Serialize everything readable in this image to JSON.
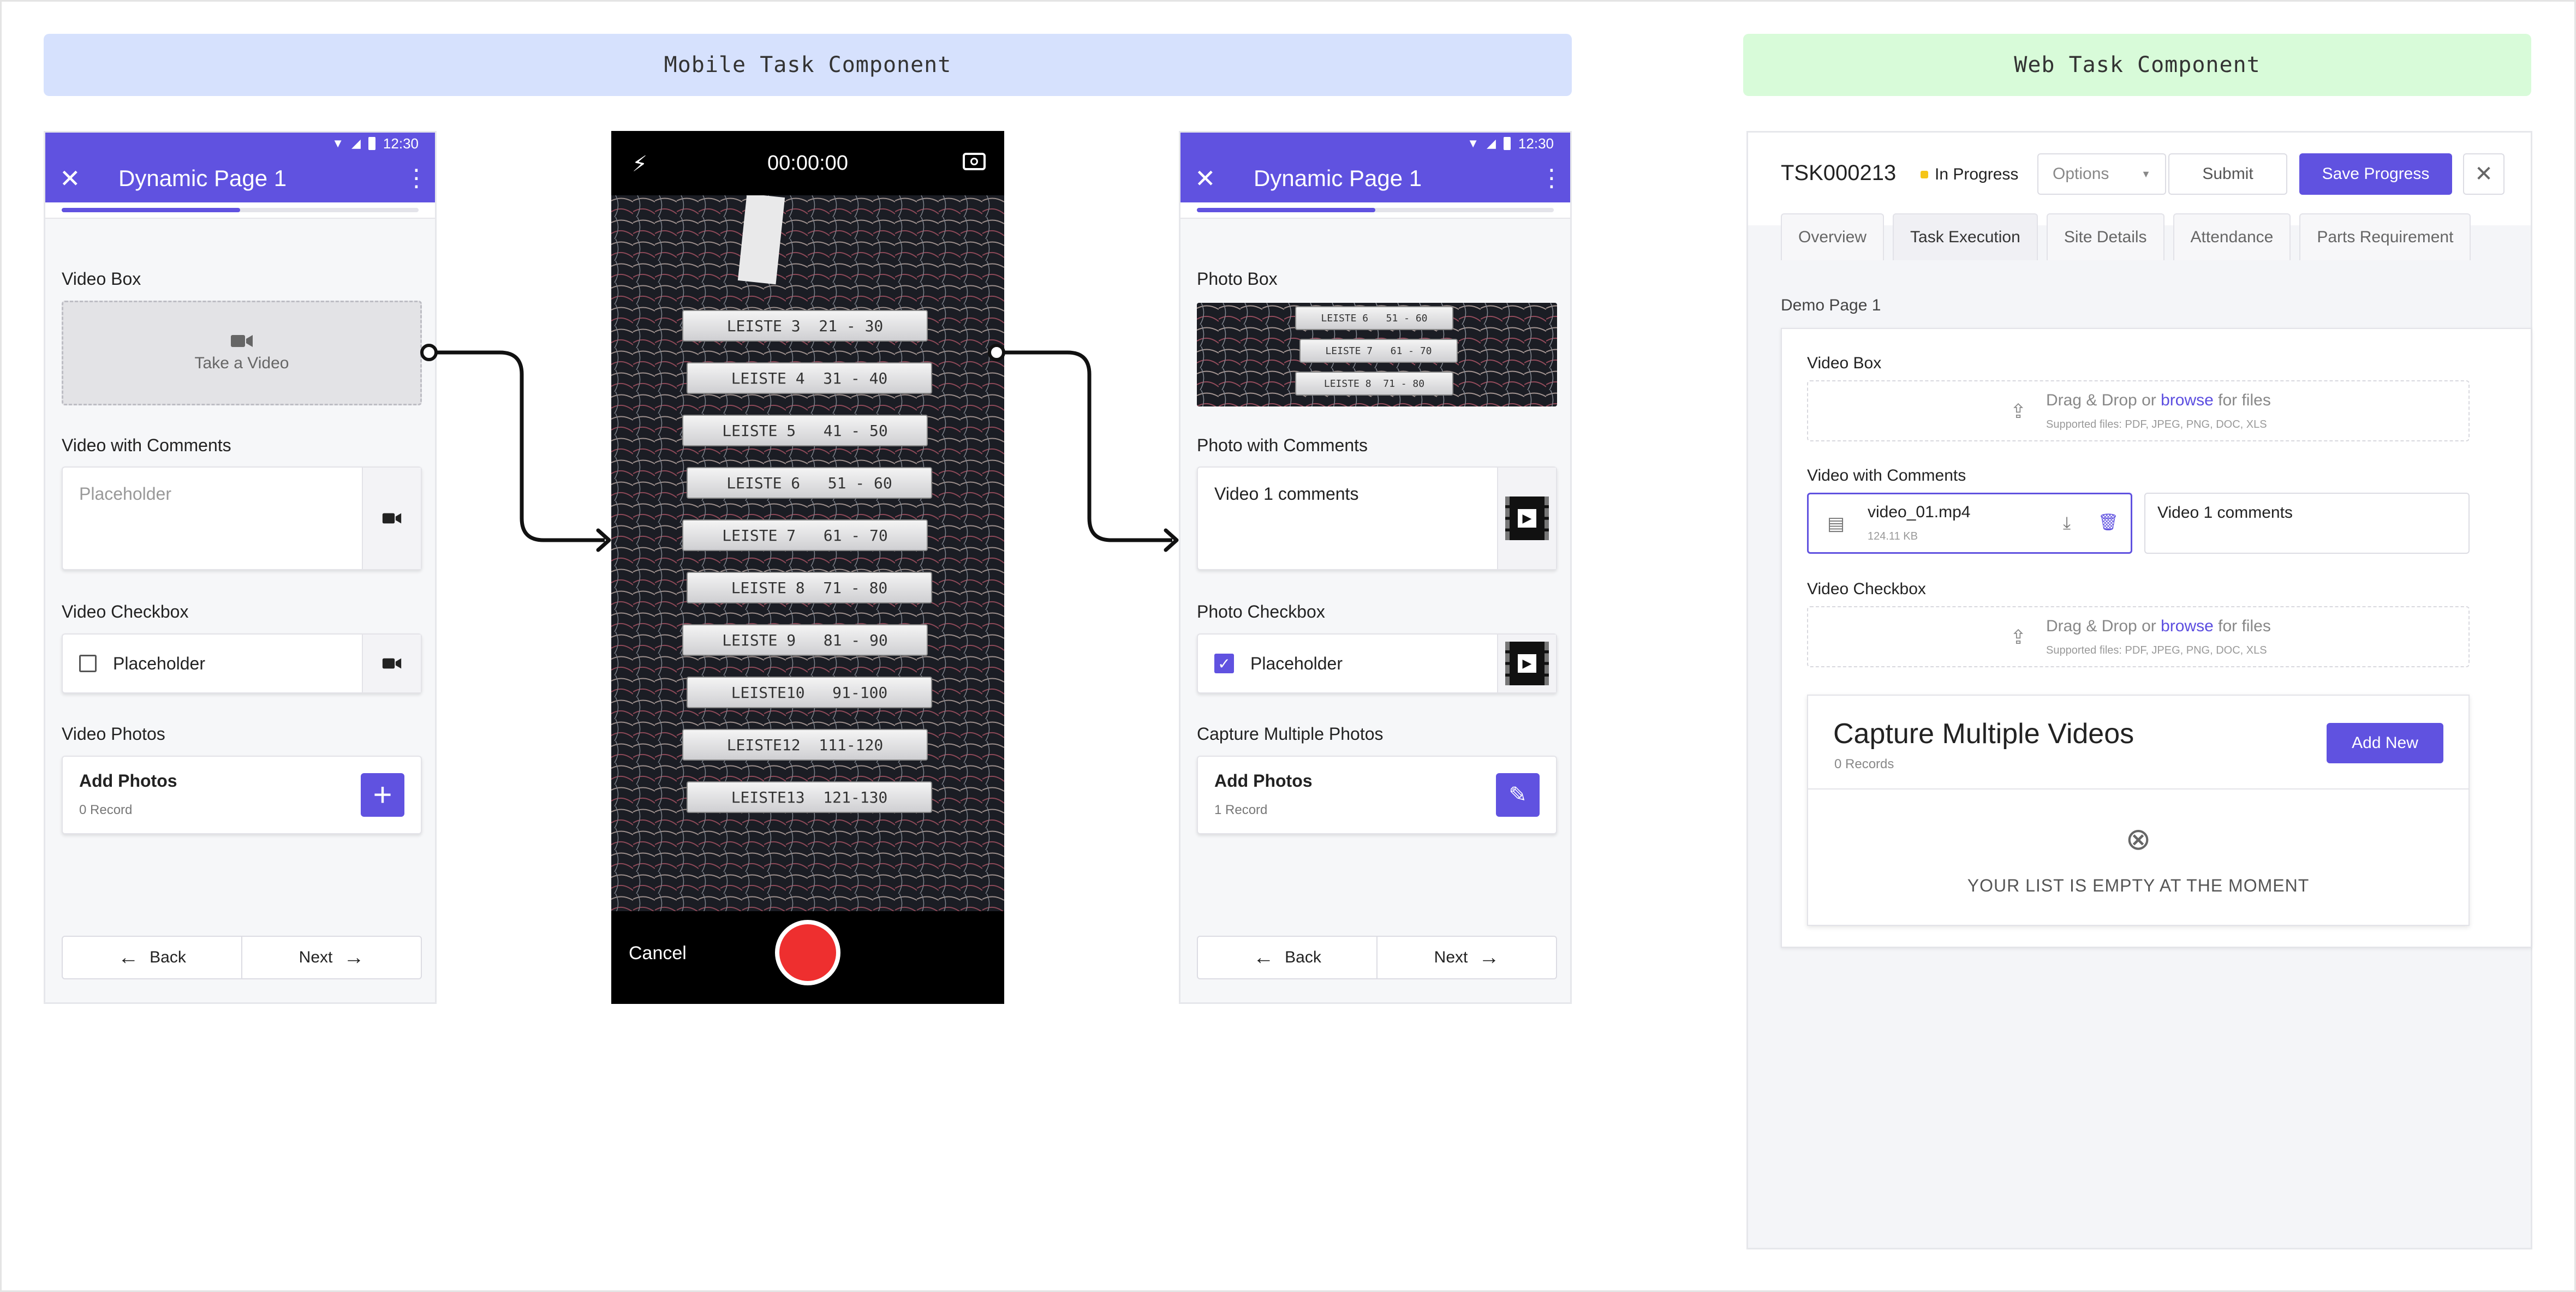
{
  "banners": {
    "mobile": "Mobile Task Component",
    "web": "Web Task Component"
  },
  "colors": {
    "primary": "#6052e0",
    "record": "#ee2f2f",
    "status_dot": "#f5c518",
    "link": "#5b4de0",
    "mobile_banner": "#d6e1fd",
    "web_banner": "#d8fbd9"
  },
  "phone1": {
    "time": "12:30",
    "title": "Dynamic Page 1",
    "progress": 0.5,
    "video_box": {
      "label": "Video Box",
      "button": "Take a Video",
      "icon": "video-camera-icon"
    },
    "video_comments": {
      "label": "Video with Comments",
      "placeholder": "Placeholder"
    },
    "video_checkbox": {
      "label": "Video Checkbox",
      "text": "Placeholder",
      "checked": false
    },
    "video_photos": {
      "label": "Video Photos",
      "card_title": "Add Photos",
      "count": "0 Record"
    },
    "nav": {
      "back": "Back",
      "next": "Next"
    }
  },
  "camera": {
    "timer": "00:00:00",
    "cancel": "Cancel",
    "labels": [
      "LEISTE 3  21 - 30",
      "LEISTE 4  31 - 40",
      "LEISTE 5   41 - 50",
      "LEISTE 6   51 - 60",
      "LEISTE 7   61 - 70",
      "LEISTE 8  71 - 80",
      "LEISTE 9   81 - 90",
      "LEISTE10   91-100",
      "LEISTE12  111-120",
      "LEISTE13  121-130"
    ]
  },
  "phone2": {
    "time": "12:30",
    "title": "Dynamic Page 1",
    "progress": 0.5,
    "photo_box": {
      "label": "Photo Box",
      "labels": [
        "LEISTE 6   51 - 60",
        "LEISTE 7   61 - 70",
        "LEISTE 8  71 - 80"
      ]
    },
    "photo_comments": {
      "label": "Photo with Comments",
      "text": "Video 1 comments"
    },
    "photo_checkbox": {
      "label": "Photo Checkbox",
      "text": "Placeholder",
      "checked": true
    },
    "capture": {
      "label": "Capture Multiple Photos",
      "card_title": "Add Photos",
      "count": "1 Record"
    },
    "nav": {
      "back": "Back",
      "next": "Next"
    }
  },
  "web": {
    "task_id": "TSK000213",
    "status": "In Progress",
    "options": "Options",
    "submit": "Submit",
    "save": "Save Progress",
    "tabs": [
      "Overview",
      "Task Execution",
      "Site Details",
      "Attendance",
      "Parts Requirement"
    ],
    "active_tab": "Task Execution",
    "page_title": "Demo Page 1",
    "video_box": {
      "label": "Video Box",
      "drop_pre": "Drag & Drop or ",
      "browse": "browse",
      "drop_post": " for files",
      "supported": "Supported files: PDF, JPEG, PNG, DOC, XLS"
    },
    "video_comments": {
      "label": "Video with Comments",
      "file_name": "video_01.mp4",
      "file_size": "124.11 KB",
      "comment": "Video 1 comments"
    },
    "video_checkbox": {
      "label": "Video Checkbox",
      "drop_pre": "Drag & Drop or ",
      "browse": "browse",
      "drop_post": " for files",
      "supported": "Supported files: PDF, JPEG, PNG, DOC, XLS"
    },
    "capture": {
      "title": "Capture Multiple Videos",
      "records": "0 Records",
      "add_new": "Add New",
      "empty": "YOUR LIST IS EMPTY AT THE MOMENT"
    }
  }
}
